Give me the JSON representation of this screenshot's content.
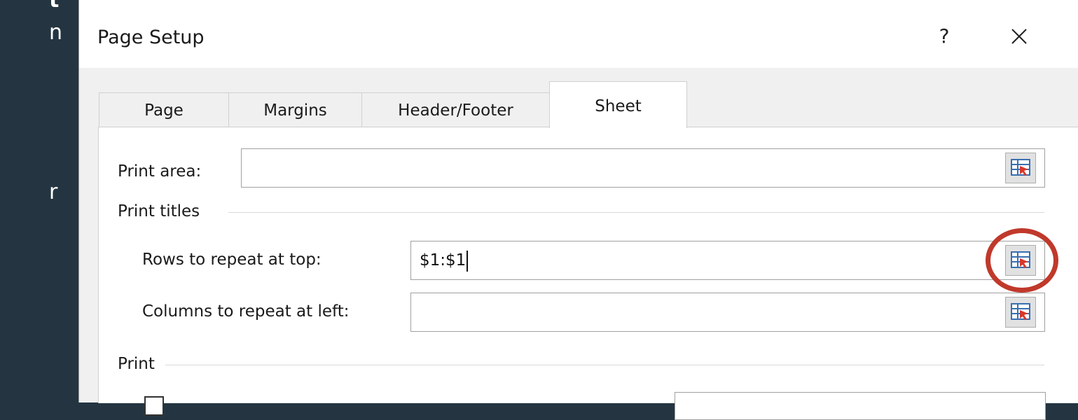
{
  "slide": {
    "text_fragments": [
      "t",
      "n",
      "r"
    ]
  },
  "dialog": {
    "title": "Page Setup",
    "help_label": "?",
    "tabs": [
      {
        "label": "Page"
      },
      {
        "label": "Margins"
      },
      {
        "label": "Header/Footer"
      },
      {
        "label": "Sheet"
      }
    ],
    "active_tab": "Sheet",
    "print_area": {
      "label": "Print area:",
      "value": ""
    },
    "print_titles": {
      "section_label": "Print titles",
      "rows_label": "Rows to repeat at top:",
      "rows_value": "$1:$1",
      "cols_label": "Columns to repeat at left:",
      "cols_value": ""
    },
    "print_section_label": "Print"
  },
  "colors": {
    "accent_arrow": "#7cb733",
    "highlight_ring": "#c0392b",
    "slide_background": "#243541"
  }
}
